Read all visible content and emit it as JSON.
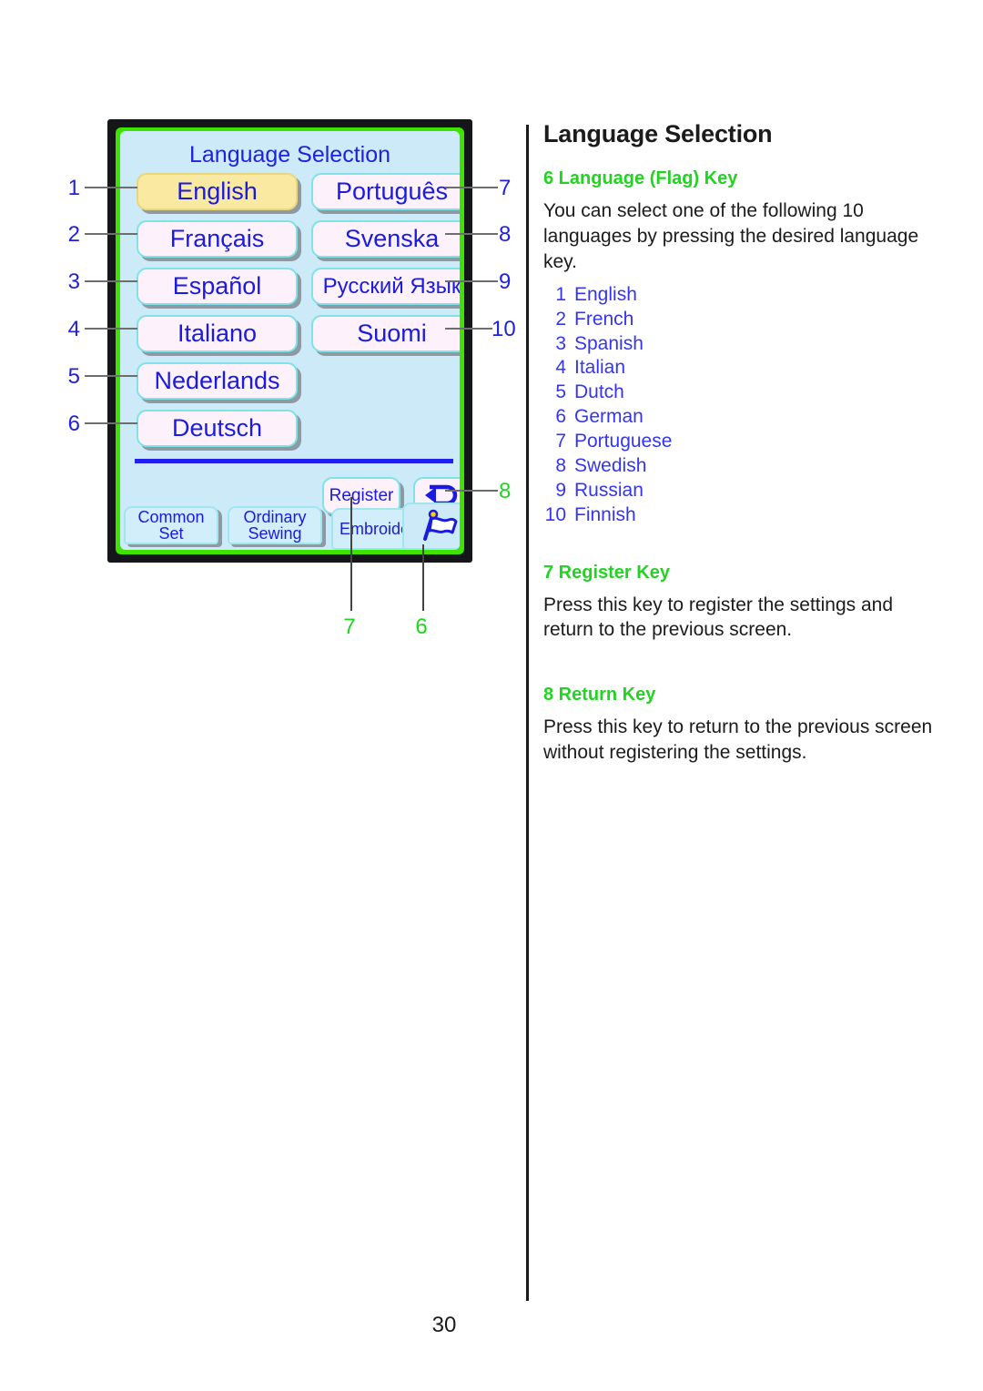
{
  "page": {
    "number": "30"
  },
  "lcd": {
    "title": "Language Selection",
    "languages": [
      {
        "label": "English",
        "selected": true
      },
      {
        "label": "Français",
        "selected": false
      },
      {
        "label": "Español",
        "selected": false
      },
      {
        "label": "Italiano",
        "selected": false
      },
      {
        "label": "Nederlands",
        "selected": false
      },
      {
        "label": "Deutsch",
        "selected": false
      },
      {
        "label": "Português",
        "selected": false
      },
      {
        "label": "Svenska",
        "selected": false
      },
      {
        "label": "Русский Язык",
        "selected": false
      },
      {
        "label": "Suomi",
        "selected": false
      }
    ],
    "register_label": "Register",
    "return_icon": "return-arrow-icon",
    "flag_icon": "flag-icon",
    "tabs": [
      {
        "line1": "Common",
        "line2": "Set"
      },
      {
        "line1": "Ordinary",
        "line2": "Sewing"
      },
      {
        "line1": "Embroidery",
        "line2": ""
      }
    ]
  },
  "callouts": {
    "left": [
      "1",
      "2",
      "3",
      "4",
      "5",
      "6"
    ],
    "right": [
      "7",
      "8",
      "9",
      "10"
    ],
    "return_key": "8",
    "bottom_register": "7",
    "bottom_flag": "6"
  },
  "panel": {
    "title": "Language Selection",
    "section_language": {
      "heading": "6 Language (Flag) Key",
      "body": "You can select one of the following 10 languages by pressing the desired language key.",
      "items": [
        {
          "num": "1",
          "name": "English"
        },
        {
          "num": "2",
          "name": "French"
        },
        {
          "num": "3",
          "name": "Spanish"
        },
        {
          "num": "4",
          "name": "Italian"
        },
        {
          "num": "5",
          "name": "Dutch"
        },
        {
          "num": "6",
          "name": "German"
        },
        {
          "num": "7",
          "name": "Portuguese"
        },
        {
          "num": "8",
          "name": "Swedish"
        },
        {
          "num": "9",
          "name": "Russian"
        },
        {
          "num": "10",
          "name": "Finnish"
        }
      ]
    },
    "section_register": {
      "heading": "7 Register Key",
      "body": "Press this key to register the settings and return to the previous screen."
    },
    "section_return": {
      "heading": "8 Return Key",
      "body": "Press this key to return to the previous screen without registering the settings."
    }
  },
  "colors": {
    "accent_green": "#22d422",
    "lcd_blue_text": "#1a1ae0",
    "lcd_bg": "#cceaf8",
    "selected_key": "#fae9a0",
    "bezel_green": "#3ee400"
  }
}
